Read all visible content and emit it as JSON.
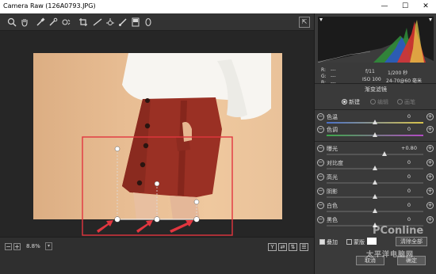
{
  "window": {
    "title": "Camera Raw (126A0793.JPG)",
    "minimize": "—",
    "maximize": "☐",
    "close": "✕"
  },
  "toolbar": {
    "tools": [
      "zoom-tool",
      "hand-tool",
      "white-balance-tool",
      "color-sampler-tool",
      "targeted-adjustment-tool",
      "crop-tool",
      "straighten-tool",
      "spot-removal-tool",
      "red-eye-tool",
      "adjustment-brush",
      "graduated-filter",
      "radial-filter"
    ],
    "export_label": "⇱"
  },
  "bottombar": {
    "zoom_minus": "−",
    "zoom_plus": "+",
    "zoom_value": "8.8%",
    "view_buttons": [
      "Y",
      "⇄",
      "⇅",
      "☰"
    ]
  },
  "histogram": {
    "r_label": "R:",
    "g_label": "G:",
    "b_label": "B:",
    "r_value": "---",
    "g_value": "---",
    "b_value": "---",
    "aperture": "f/11",
    "shutter": "1/200 秒",
    "iso": "ISO 100",
    "lens": "24-70@60 毫米"
  },
  "panel": {
    "section_title": "渐变滤镜",
    "modes": [
      {
        "label": "新建",
        "active": true
      },
      {
        "label": "编辑",
        "active": false
      },
      {
        "label": "画笔",
        "active": false
      }
    ],
    "sliders": [
      {
        "name": "色温",
        "value": "0",
        "level": 0.5,
        "track": "temp"
      },
      {
        "name": "色调",
        "value": "0",
        "level": 0.5,
        "track": "tint"
      },
      {
        "name": "曝光",
        "value": "+0.80",
        "level": 0.6,
        "track": "gray"
      },
      {
        "name": "对比度",
        "value": "0",
        "level": 0.5,
        "track": "gray"
      },
      {
        "name": "高光",
        "value": "0",
        "level": 0.5,
        "track": "gray"
      },
      {
        "name": "阴影",
        "value": "0",
        "level": 0.5,
        "track": "gray"
      },
      {
        "name": "白色",
        "value": "0",
        "level": 0.5,
        "track": "gray"
      },
      {
        "name": "黑色",
        "value": "0",
        "level": 0.5,
        "track": "gray"
      }
    ],
    "overlay_label": "叠加",
    "mask_label": "蒙版",
    "clear_all_label": "清除全部",
    "cancel_label": "取消",
    "ok_label": "确定"
  },
  "watermark": {
    "line1": "PConline",
    "line2": "太平洋电脑网"
  },
  "colors": {
    "accent_red": "#e2363f",
    "skirt": "#9a3024",
    "sweater": "#f6f4f0",
    "background": "#2b2b2b"
  }
}
